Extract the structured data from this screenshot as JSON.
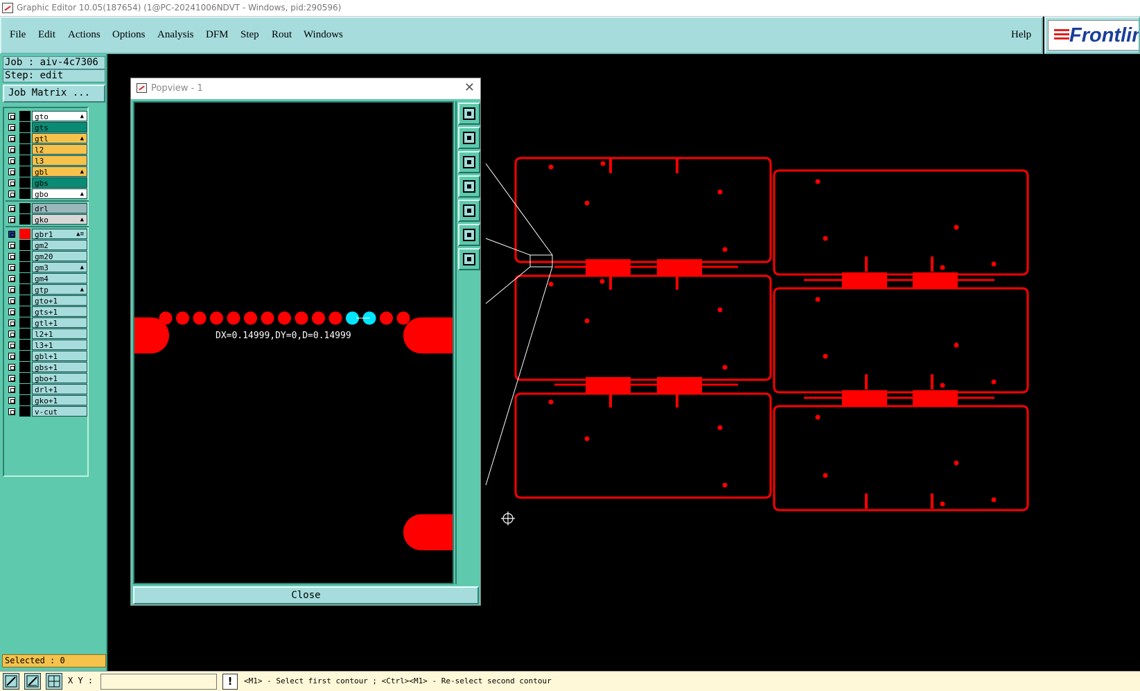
{
  "window": {
    "title": "Graphic Editor 10.05(187654) (1@PC-20241006NDVT - Windows, pid:290596)"
  },
  "menu": [
    "File",
    "Edit",
    "Actions",
    "Options",
    "Analysis",
    "DFM",
    "Step",
    "Rout",
    "Windows"
  ],
  "help_label": "Help",
  "logo_text": "Frontline",
  "job": {
    "job_label": "Job : aiv-4c7306",
    "step_label": "Step: edit",
    "matrix_button": "Job Matrix ..."
  },
  "layers": [
    {
      "name": "gto",
      "color": "#ffffff",
      "flag": "▲"
    },
    {
      "name": "gts",
      "color": "#0a8c74",
      "flag": ""
    },
    {
      "name": "gtl",
      "color": "#f7c24c",
      "flag": "▲"
    },
    {
      "name": "l2",
      "color": "#f7c24c",
      "flag": ""
    },
    {
      "name": "l3",
      "color": "#f7c24c",
      "flag": ""
    },
    {
      "name": "gbl",
      "color": "#f7c24c",
      "flag": "▲"
    },
    {
      "name": "gbs",
      "color": "#0a8c74",
      "flag": ""
    },
    {
      "name": "gbo",
      "color": "#ffffff",
      "flag": "▲"
    },
    {
      "name": "drl",
      "color": "#9ab8bc",
      "flag": ""
    },
    {
      "name": "gko",
      "color": "#d8d8d8",
      "flag": "▲"
    },
    {
      "name": "gbr1",
      "color": "#a6dcdc",
      "flag": "▲≡",
      "active": true
    },
    {
      "name": "gm2",
      "color": "#a6dcdc",
      "flag": ""
    },
    {
      "name": "gm20",
      "color": "#a6dcdc",
      "flag": ""
    },
    {
      "name": "gm3",
      "color": "#a6dcdc",
      "flag": "▲"
    },
    {
      "name": "gm4",
      "color": "#a6dcdc",
      "flag": ""
    },
    {
      "name": "gtp",
      "color": "#a6dcdc",
      "flag": "▲"
    },
    {
      "name": "gto+1",
      "color": "#a6dcdc",
      "flag": ""
    },
    {
      "name": "gts+1",
      "color": "#a6dcdc",
      "flag": ""
    },
    {
      "name": "gtl+1",
      "color": "#a6dcdc",
      "flag": ""
    },
    {
      "name": "l2+1",
      "color": "#a6dcdc",
      "flag": ""
    },
    {
      "name": "l3+1",
      "color": "#a6dcdc",
      "flag": ""
    },
    {
      "name": "gbl+1",
      "color": "#a6dcdc",
      "flag": ""
    },
    {
      "name": "gbs+1",
      "color": "#a6dcdc",
      "flag": ""
    },
    {
      "name": "gbo+1",
      "color": "#a6dcdc",
      "flag": ""
    },
    {
      "name": "drl+1",
      "color": "#a6dcdc",
      "flag": ""
    },
    {
      "name": "gko+1",
      "color": "#a6dcdc",
      "flag": ""
    },
    {
      "name": "v-cut",
      "color": "#a6dcdc",
      "flag": ""
    }
  ],
  "selected_label": "Selected : 0",
  "popview": {
    "title": "Popview - 1",
    "measurement": "DX=0.14999,DY=0,D=0.14999",
    "close_label": "Close",
    "tools": [
      "zoom-in-icon",
      "zoom-out-up-icon",
      "zoom-down-icon",
      "pan-left-icon",
      "pan-right-icon",
      "fit-icon",
      "center-icon"
    ]
  },
  "status": {
    "xy_label": "X Y :",
    "xy_value": "",
    "message": "<M1> - Select first contour ; <Ctrl><M1> - Re-select second contour"
  },
  "colors": {
    "trace": "#ff0000",
    "highlight": "#00e5ff",
    "panel": "#5ec9ad",
    "menubar": "#a6dcdc"
  }
}
